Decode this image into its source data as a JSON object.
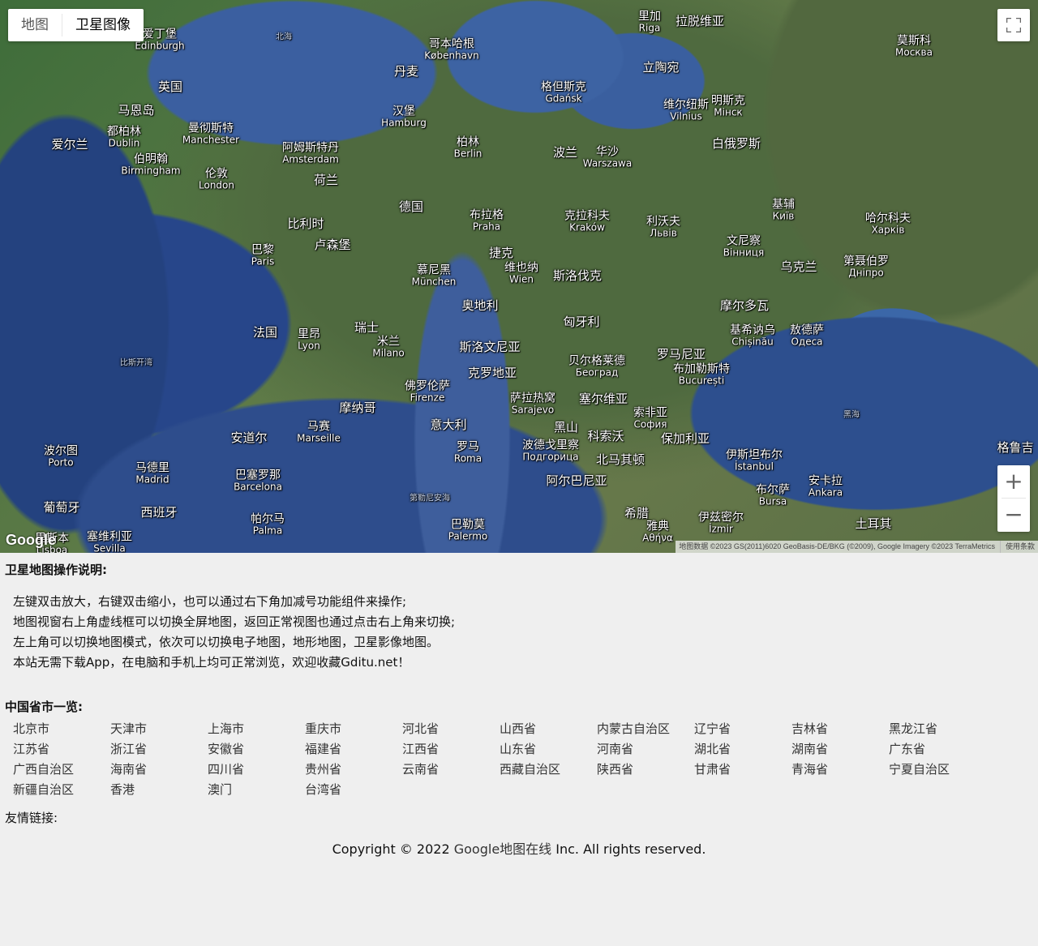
{
  "map": {
    "type_buttons": [
      "地图",
      "卫星图像"
    ],
    "active_type": "卫星图像",
    "zoom_in": "+",
    "zoom_out": "−",
    "logo": "Google",
    "attribution": "地图数据 ©2023 GS(2011)6020 GeoBasis-DE/BKG (©2009), Google Imagery ©2023 TerraMetrics",
    "terms": "使用条款",
    "labels": [
      {
        "cn": "爱丁堡",
        "lt": "Edinburgh"
      },
      {
        "cn": "北海",
        "lt": ""
      },
      {
        "cn": "哥本哈根",
        "lt": "København"
      },
      {
        "cn": "丹麦",
        "lt": ""
      },
      {
        "cn": "里加",
        "lt": "Riga"
      },
      {
        "cn": "拉脱维亚",
        "lt": ""
      },
      {
        "cn": "莫斯科",
        "lt": "Москва"
      },
      {
        "cn": "英国",
        "lt": ""
      },
      {
        "cn": "马恩岛",
        "lt": ""
      },
      {
        "cn": "立陶宛",
        "lt": ""
      },
      {
        "cn": "格但斯克",
        "lt": "Gdańsk"
      },
      {
        "cn": "汉堡",
        "lt": "Hamburg"
      },
      {
        "cn": "维尔纽斯",
        "lt": "Vilnius"
      },
      {
        "cn": "明斯克",
        "lt": "Мінск"
      },
      {
        "cn": "爱尔兰",
        "lt": ""
      },
      {
        "cn": "都柏林",
        "lt": "Dublin"
      },
      {
        "cn": "曼彻斯特",
        "lt": "Manchester"
      },
      {
        "cn": "柏林",
        "lt": "Berlin"
      },
      {
        "cn": "波兰",
        "lt": ""
      },
      {
        "cn": "华沙",
        "lt": "Warszawa"
      },
      {
        "cn": "白俄罗斯",
        "lt": ""
      },
      {
        "cn": "阿姆斯特丹",
        "lt": "Amsterdam"
      },
      {
        "cn": "伯明翰",
        "lt": "Birmingham"
      },
      {
        "cn": "伦敦",
        "lt": "London"
      },
      {
        "cn": "荷兰",
        "lt": ""
      },
      {
        "cn": "德国",
        "lt": ""
      },
      {
        "cn": "基辅",
        "lt": "Київ"
      },
      {
        "cn": "比利时",
        "lt": ""
      },
      {
        "cn": "布拉格",
        "lt": "Praha"
      },
      {
        "cn": "克拉科夫",
        "lt": "Kraków"
      },
      {
        "cn": "利沃夫",
        "lt": "Львів"
      },
      {
        "cn": "哈尔科夫",
        "lt": "Харків"
      },
      {
        "cn": "卢森堡",
        "lt": ""
      },
      {
        "cn": "巴黎",
        "lt": "Paris"
      },
      {
        "cn": "捷克",
        "lt": ""
      },
      {
        "cn": "文尼察",
        "lt": "Вінниця"
      },
      {
        "cn": "乌克兰",
        "lt": ""
      },
      {
        "cn": "第聂伯罗",
        "lt": "Дніпро"
      },
      {
        "cn": "慕尼黑",
        "lt": "München"
      },
      {
        "cn": "维也纳",
        "lt": "Wien"
      },
      {
        "cn": "斯洛伐克",
        "lt": ""
      },
      {
        "cn": "奥地利",
        "lt": ""
      },
      {
        "cn": "摩尔多瓦",
        "lt": ""
      },
      {
        "cn": "匈牙利",
        "lt": ""
      },
      {
        "cn": "法国",
        "lt": ""
      },
      {
        "cn": "里昂",
        "lt": "Lyon"
      },
      {
        "cn": "瑞士",
        "lt": ""
      },
      {
        "cn": "米兰",
        "lt": "Milano"
      },
      {
        "cn": "基希讷乌",
        "lt": "Chișinău"
      },
      {
        "cn": "敖德萨",
        "lt": "Одеса"
      },
      {
        "cn": "斯洛文尼亚",
        "lt": ""
      },
      {
        "cn": "罗马尼亚",
        "lt": ""
      },
      {
        "cn": "比斯开湾",
        "lt": ""
      },
      {
        "cn": "贝尔格莱德",
        "lt": "Београд"
      },
      {
        "cn": "克罗地亚",
        "lt": ""
      },
      {
        "cn": "布加勒斯特",
        "lt": "București"
      },
      {
        "cn": "佛罗伦萨",
        "lt": "Firenze"
      },
      {
        "cn": "萨拉热窝",
        "lt": "Sarajevo"
      },
      {
        "cn": "塞尔维亚",
        "lt": ""
      },
      {
        "cn": "摩纳哥",
        "lt": ""
      },
      {
        "cn": "黑海",
        "lt": ""
      },
      {
        "cn": "意大利",
        "lt": ""
      },
      {
        "cn": "黑山",
        "lt": ""
      },
      {
        "cn": "索非亚",
        "lt": "София"
      },
      {
        "cn": "马赛",
        "lt": "Marseille"
      },
      {
        "cn": "安道尔",
        "lt": ""
      },
      {
        "cn": "科索沃",
        "lt": ""
      },
      {
        "cn": "保加利亚",
        "lt": ""
      },
      {
        "cn": "波尔图",
        "lt": "Porto"
      },
      {
        "cn": "罗马",
        "lt": "Roma"
      },
      {
        "cn": "格鲁吉",
        "lt": ""
      },
      {
        "cn": "波德戈里察",
        "lt": "Подгорица"
      },
      {
        "cn": "北马其顿",
        "lt": ""
      },
      {
        "cn": "伊斯坦布尔",
        "lt": "İstanbul"
      },
      {
        "cn": "马德里",
        "lt": "Madrid"
      },
      {
        "cn": "巴塞罗那",
        "lt": "Barcelona"
      },
      {
        "cn": "阿尔巴尼亚",
        "lt": ""
      },
      {
        "cn": "安卡拉",
        "lt": "Ankara"
      },
      {
        "cn": "葡萄牙",
        "lt": ""
      },
      {
        "cn": "第勒尼安海",
        "lt": ""
      },
      {
        "cn": "布尔萨",
        "lt": "Bursa"
      },
      {
        "cn": "西班牙",
        "lt": ""
      },
      {
        "cn": "希腊",
        "lt": ""
      },
      {
        "cn": "帕尔马",
        "lt": "Palma"
      },
      {
        "cn": "巴勒莫",
        "lt": "Palermo"
      },
      {
        "cn": "伊兹密尔",
        "lt": "İzmir"
      },
      {
        "cn": "土耳其",
        "lt": ""
      },
      {
        "cn": "雅典",
        "lt": "Αθήνα"
      },
      {
        "cn": "里斯本",
        "lt": "Lisboa"
      },
      {
        "cn": "塞维利亚",
        "lt": "Sevilla"
      }
    ]
  },
  "instructions": {
    "title": "卫星地图操作说明:",
    "lines": [
      "左键双击放大，右键双击缩小，也可以通过右下角加减号功能组件来操作;",
      "地图视窗右上角虚线框可以切换全屏地图，返回正常视图也通过点击右上角来切换;",
      "左上角可以切换地图模式，依次可以切换电子地图，地形地图，卫星影像地图。",
      "本站无需下载App，在电脑和手机上均可正常浏览，欢迎收藏Gditu.net！"
    ]
  },
  "provinces": {
    "title": "中国省市一览:",
    "items": [
      "北京市",
      "天津市",
      "上海市",
      "重庆市",
      "河北省",
      "山西省",
      "内蒙古自治区",
      "辽宁省",
      "吉林省",
      "黑龙江省",
      "江苏省",
      "浙江省",
      "安徽省",
      "福建省",
      "江西省",
      "山东省",
      "河南省",
      "湖北省",
      "湖南省",
      "广东省",
      "广西自治区",
      "海南省",
      "四川省",
      "贵州省",
      "云南省",
      "西藏自治区",
      "陕西省",
      "甘肃省",
      "青海省",
      "宁夏自治区",
      "新疆自治区",
      "香港",
      "澳门",
      "台湾省"
    ]
  },
  "friend_links": "友情链接:",
  "footer": {
    "prefix": "Copyright © 2022 ",
    "link": "Google地图在线",
    "suffix": " Inc. All rights reserved."
  }
}
